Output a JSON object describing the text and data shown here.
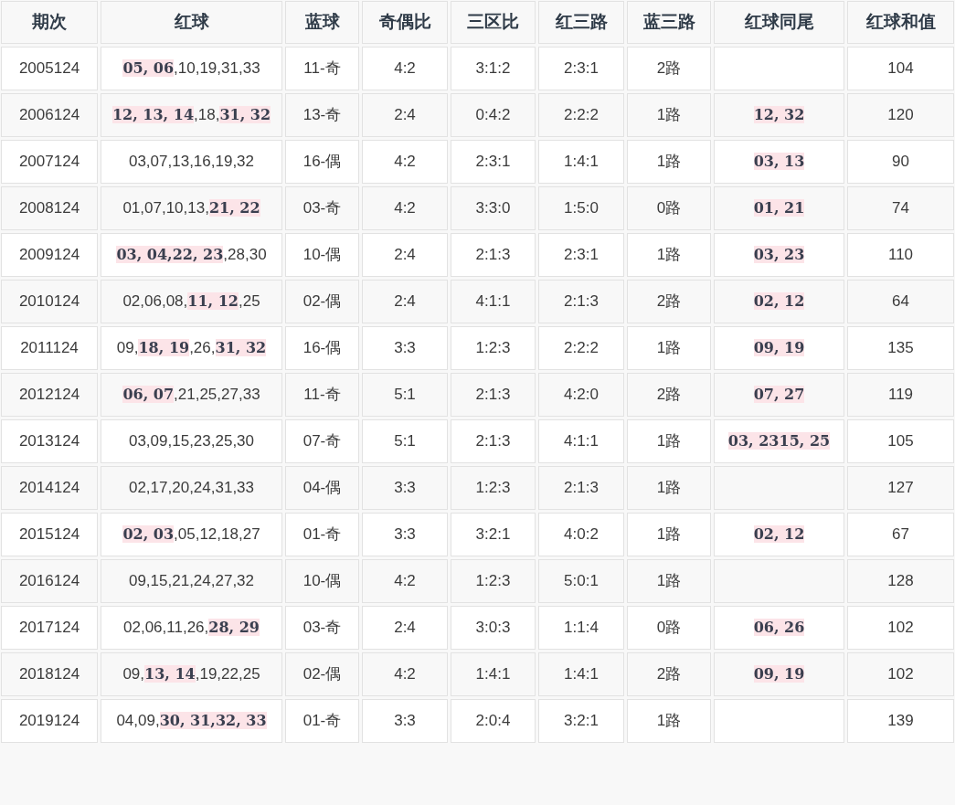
{
  "table": {
    "columns": [
      "期次",
      "红球",
      "蓝球",
      "奇偶比",
      "三区比",
      "红三路",
      "蓝三路",
      "红球同尾",
      "红球和值"
    ],
    "rows": [
      {
        "issue": "2005124",
        "red_balls": [
          {
            "text": "05, 06",
            "highlighted": true
          },
          {
            "text": ",10,19,31,33",
            "highlighted": false
          }
        ],
        "blue": "11-奇",
        "odd_even": "4:2",
        "zones": "3:1:2",
        "red_mod3": "2:3:1",
        "blue_mod3": "2路",
        "sum": "104"
      },
      {
        "issue": "2006124",
        "red_balls": [
          {
            "text": "12, 13, 14",
            "highlighted": true
          },
          {
            "text": ",18,",
            "highlighted": false
          },
          {
            "text": "31, 32",
            "highlighted": true
          }
        ],
        "blue": "13-奇",
        "odd_even": "2:4",
        "zones": "0:4:2",
        "red_mod3": "2:2:2",
        "blue_mod3": "1路",
        "same_tail": [
          {
            "text": "12, 32",
            "highlighted": true
          }
        ],
        "sum": "120"
      },
      {
        "issue": "2007124",
        "red_balls": [
          {
            "text": "03,07,13,16,19,32",
            "highlighted": false
          }
        ],
        "blue": "16-偶",
        "odd_even": "4:2",
        "zones": "2:3:1",
        "red_mod3": "1:4:1",
        "blue_mod3": "1路",
        "same_tail": [
          {
            "text": "03, 13",
            "highlighted": true
          }
        ],
        "sum": "90"
      },
      {
        "issue": "2008124",
        "red_balls": [
          {
            "text": "01,07,10,13,",
            "highlighted": false
          },
          {
            "text": "21, 22",
            "highlighted": true
          }
        ],
        "blue": "03-奇",
        "odd_even": "4:2",
        "zones": "3:3:0",
        "red_mod3": "1:5:0",
        "blue_mod3": "0路",
        "same_tail": [
          {
            "text": "01, 21",
            "highlighted": true
          }
        ],
        "sum": "74"
      },
      {
        "issue": "2009124",
        "red_balls": [
          {
            "text": "03, 04,",
            "highlighted": true
          },
          {
            "text": "22, 23",
            "highlighted": true
          },
          {
            "text": ",28,30",
            "highlighted": false
          }
        ],
        "blue": "10-偶",
        "odd_even": "2:4",
        "zones": "2:1:3",
        "red_mod3": "2:3:1",
        "blue_mod3": "1路",
        "same_tail": [
          {
            "text": "03, 23",
            "highlighted": true
          }
        ],
        "sum": "110"
      },
      {
        "issue": "2010124",
        "red_balls": [
          {
            "text": "02,06,08,",
            "highlighted": false
          },
          {
            "text": "11, 12",
            "highlighted": true
          },
          {
            "text": ",25",
            "highlighted": false
          }
        ],
        "blue": "02-偶",
        "odd_even": "2:4",
        "zones": "4:1:1",
        "red_mod3": "2:1:3",
        "blue_mod3": "2路",
        "same_tail": [
          {
            "text": "02, 12",
            "highlighted": true
          }
        ],
        "sum": "64"
      },
      {
        "issue": "2011124",
        "red_balls": [
          {
            "text": "09,",
            "highlighted": false
          },
          {
            "text": "18, 19",
            "highlighted": true
          },
          {
            "text": ",26,",
            "highlighted": false
          },
          {
            "text": "31, 32",
            "highlighted": true
          }
        ],
        "blue": "16-偶",
        "odd_even": "3:3",
        "zones": "1:2:3",
        "red_mod3": "2:2:2",
        "blue_mod3": "1路",
        "same_tail": [
          {
            "text": "09, 19",
            "highlighted": true
          }
        ],
        "sum": "135"
      },
      {
        "issue": "2012124",
        "red_balls": [
          {
            "text": "06, 07",
            "highlighted": true
          },
          {
            "text": ",21,25,27,33",
            "highlighted": false
          }
        ],
        "blue": "11-奇",
        "odd_even": "5:1",
        "zones": "2:1:3",
        "red_mod3": "4:2:0",
        "blue_mod3": "2路",
        "same_tail": [
          {
            "text": "07, 27",
            "highlighted": true
          }
        ],
        "sum": "119"
      },
      {
        "issue": "2013124",
        "red_balls": [
          {
            "text": "03,09,15,23,25,30",
            "highlighted": false
          }
        ],
        "blue": "07-奇",
        "odd_even": "5:1",
        "zones": "2:1:3",
        "red_mod3": "4:1:1",
        "blue_mod3": "1路",
        "same_tail": [
          {
            "text": "03, 23",
            "highlighted": true
          },
          {
            "text": "15, 25",
            "highlighted": true
          }
        ],
        "sum": "105"
      },
      {
        "issue": "2014124",
        "red_balls": [
          {
            "text": "02,17,20,24,31,33",
            "highlighted": false
          }
        ],
        "blue": "04-偶",
        "odd_even": "3:3",
        "zones": "1:2:3",
        "red_mod3": "2:1:3",
        "blue_mod3": "1路",
        "sum": "127"
      },
      {
        "issue": "2015124",
        "red_balls": [
          {
            "text": "02, 03",
            "highlighted": true
          },
          {
            "text": ",05,12,18,27",
            "highlighted": false
          }
        ],
        "blue": "01-奇",
        "odd_even": "3:3",
        "zones": "3:2:1",
        "red_mod3": "4:0:2",
        "blue_mod3": "1路",
        "same_tail": [
          {
            "text": "02, 12",
            "highlighted": true
          }
        ],
        "sum": "67"
      },
      {
        "issue": "2016124",
        "red_balls": [
          {
            "text": "09,15,21,24,27,32",
            "highlighted": false
          }
        ],
        "blue": "10-偶",
        "odd_even": "4:2",
        "zones": "1:2:3",
        "red_mod3": "5:0:1",
        "blue_mod3": "1路",
        "sum": "128"
      },
      {
        "issue": "2017124",
        "red_balls": [
          {
            "text": "02,06,11,26,",
            "highlighted": false
          },
          {
            "text": "28, 29",
            "highlighted": true
          }
        ],
        "blue": "03-奇",
        "odd_even": "2:4",
        "zones": "3:0:3",
        "red_mod3": "1:1:4",
        "blue_mod3": "0路",
        "same_tail": [
          {
            "text": "06, 26",
            "highlighted": true
          }
        ],
        "sum": "102"
      },
      {
        "issue": "2018124",
        "red_balls": [
          {
            "text": "09,",
            "highlighted": false
          },
          {
            "text": "13, 14",
            "highlighted": true
          },
          {
            "text": ",19,22,25",
            "highlighted": false
          }
        ],
        "blue": "02-偶",
        "odd_even": "4:2",
        "zones": "1:4:1",
        "red_mod3": "1:4:1",
        "blue_mod3": "2路",
        "same_tail": [
          {
            "text": "09, 19",
            "highlighted": true
          }
        ],
        "sum": "102"
      },
      {
        "issue": "2019124",
        "red_balls": [
          {
            "text": "04,09,",
            "highlighted": false
          },
          {
            "text": "30, 31,",
            "highlighted": true
          },
          {
            "text": "32, 33",
            "highlighted": true
          }
        ],
        "blue": "01-奇",
        "odd_even": "3:3",
        "zones": "2:0:4",
        "red_mod3": "3:2:1",
        "blue_mod3": "1路",
        "sum": "139"
      }
    ]
  }
}
